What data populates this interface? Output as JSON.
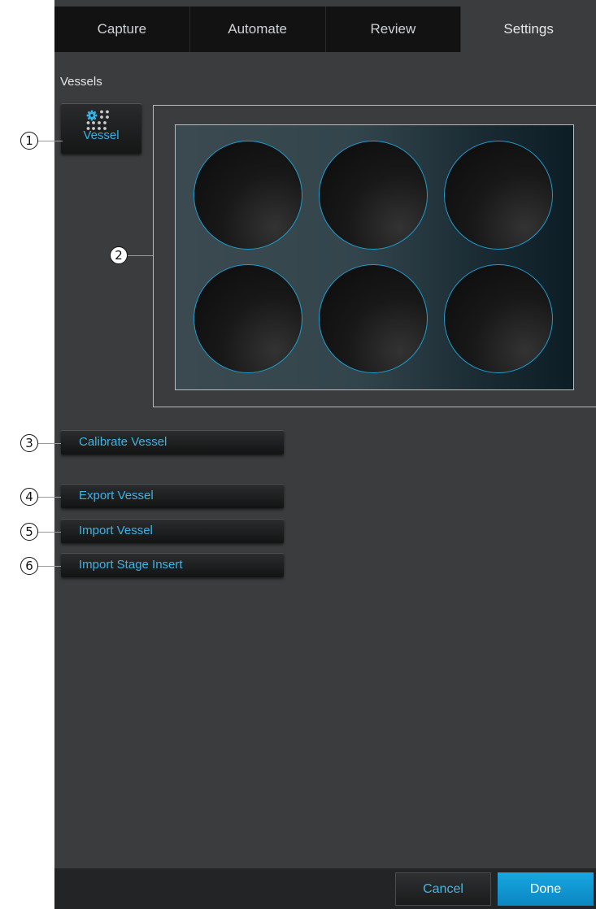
{
  "tabs": [
    {
      "label": "Capture"
    },
    {
      "label": "Automate"
    },
    {
      "label": "Review"
    },
    {
      "label": "Settings"
    }
  ],
  "active_tab": "Settings",
  "section_title": "Vessels",
  "vessel_button": {
    "label": "Vessel",
    "icon": "vessel-settings-icon"
  },
  "plate_preview": {
    "rows": 2,
    "columns": 3,
    "well_count": 6
  },
  "actions": [
    {
      "label": "Calibrate Vessel"
    },
    {
      "label": "Export Vessel"
    },
    {
      "label": "Import Vessel"
    },
    {
      "label": "Import Stage Insert"
    }
  ],
  "footer": {
    "cancel_label": "Cancel",
    "done_label": "Done"
  },
  "callouts": [
    "1",
    "2",
    "3",
    "4",
    "5",
    "6"
  ],
  "colors": {
    "accent": "#38b2e3",
    "done_button": "#12a0da",
    "background": "#3a3c3d",
    "tab_bar": "#121212"
  }
}
